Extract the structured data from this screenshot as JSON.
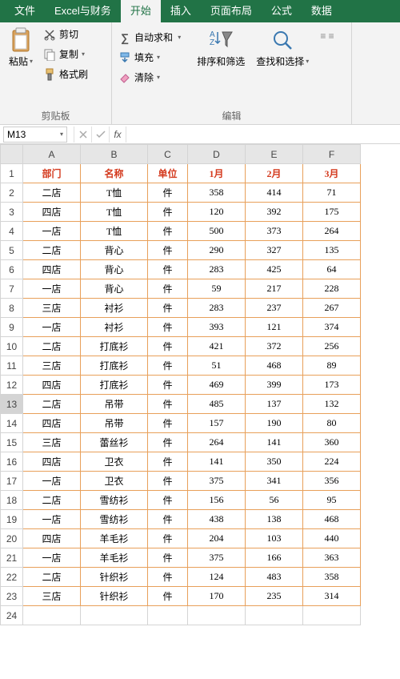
{
  "tabs": [
    "文件",
    "Excel与财务",
    "开始",
    "插入",
    "页面布局",
    "公式",
    "数据"
  ],
  "active_tab_index": 2,
  "ribbon": {
    "clipboard": {
      "paste": "粘贴",
      "cut": "剪切",
      "copy": "复制",
      "format_painter": "格式刷",
      "group_label": "剪贴板"
    },
    "editing": {
      "autosum": "自动求和",
      "fill": "填充",
      "clear": "清除",
      "sort_filter": "排序和筛选",
      "find_select": "查找和选择",
      "group_label": "编辑"
    }
  },
  "namebox": "M13",
  "fx_label": "fx",
  "columns": [
    "A",
    "B",
    "C",
    "D",
    "E",
    "F"
  ],
  "headers": [
    "部门",
    "名称",
    "单位",
    "1月",
    "2月",
    "3月"
  ],
  "selected_row": 13,
  "rows": [
    [
      "二店",
      "T恤",
      "件",
      "358",
      "414",
      "71"
    ],
    [
      "四店",
      "T恤",
      "件",
      "120",
      "392",
      "175"
    ],
    [
      "一店",
      "T恤",
      "件",
      "500",
      "373",
      "264"
    ],
    [
      "二店",
      "背心",
      "件",
      "290",
      "327",
      "135"
    ],
    [
      "四店",
      "背心",
      "件",
      "283",
      "425",
      "64"
    ],
    [
      "一店",
      "背心",
      "件",
      "59",
      "217",
      "228"
    ],
    [
      "三店",
      "衬衫",
      "件",
      "283",
      "237",
      "267"
    ],
    [
      "一店",
      "衬衫",
      "件",
      "393",
      "121",
      "374"
    ],
    [
      "二店",
      "打底衫",
      "件",
      "421",
      "372",
      "256"
    ],
    [
      "三店",
      "打底衫",
      "件",
      "51",
      "468",
      "89"
    ],
    [
      "四店",
      "打底衫",
      "件",
      "469",
      "399",
      "173"
    ],
    [
      "二店",
      "吊带",
      "件",
      "485",
      "137",
      "132"
    ],
    [
      "四店",
      "吊带",
      "件",
      "157",
      "190",
      "80"
    ],
    [
      "三店",
      "蕾丝衫",
      "件",
      "264",
      "141",
      "360"
    ],
    [
      "四店",
      "卫衣",
      "件",
      "141",
      "350",
      "224"
    ],
    [
      "一店",
      "卫衣",
      "件",
      "375",
      "341",
      "356"
    ],
    [
      "二店",
      "雪纺衫",
      "件",
      "156",
      "56",
      "95"
    ],
    [
      "一店",
      "雪纺衫",
      "件",
      "438",
      "138",
      "468"
    ],
    [
      "四店",
      "羊毛衫",
      "件",
      "204",
      "103",
      "440"
    ],
    [
      "一店",
      "羊毛衫",
      "件",
      "375",
      "166",
      "363"
    ],
    [
      "二店",
      "针织衫",
      "件",
      "124",
      "483",
      "358"
    ],
    [
      "三店",
      "针织衫",
      "件",
      "170",
      "235",
      "314"
    ]
  ],
  "empty_rows": 1
}
